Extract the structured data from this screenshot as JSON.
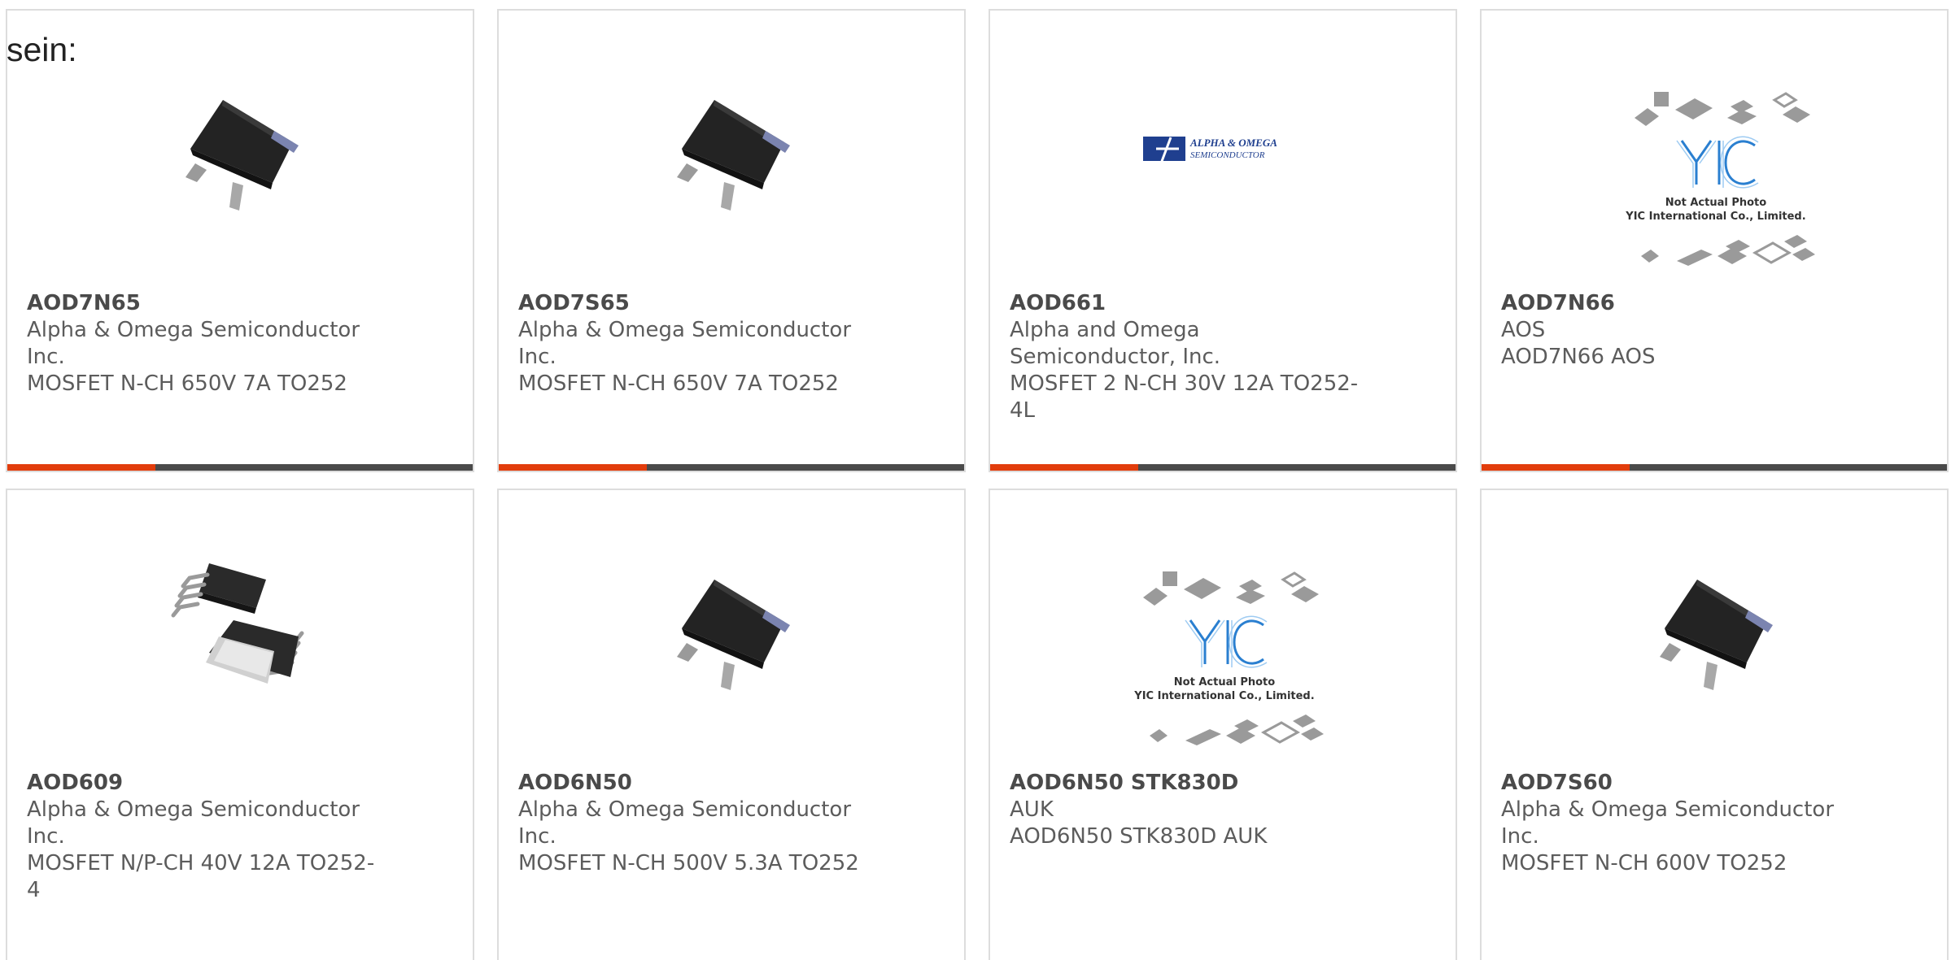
{
  "intro_text": "sein:",
  "colors": {
    "accent": "#e23d0c",
    "bar": "#4a4a4a",
    "border": "#dddddd"
  },
  "products": [
    {
      "part": "AOD7N65",
      "manufacturer": "Alpha & Omega Semiconductor Inc.",
      "description": "MOSFET N-CH 650V 7A TO252",
      "image": "to252-package-icon"
    },
    {
      "part": "AOD7S65",
      "manufacturer": "Alpha & Omega Semiconductor Inc.",
      "description": "MOSFET N-CH 650V 7A TO252",
      "image": "to252-package-icon"
    },
    {
      "part": "AOD661",
      "manufacturer": "Alpha and Omega Semiconductor, Inc.",
      "description": "MOSFET 2 N-CH 30V 12A TO252-4L",
      "image": "alpha-omega-logo",
      "logo_text": [
        "ALPHA & OMEGA",
        "SEMICONDUCTOR"
      ]
    },
    {
      "part": "AOD7N66",
      "manufacturer": "AOS",
      "description": "AOD7N66 AOS",
      "image": "yic-placeholder",
      "placeholder_text": [
        "Not Actual Photo",
        "YIC International Co., Limited."
      ]
    },
    {
      "part": "AOD609",
      "manufacturer": "Alpha & Omega Semiconductor Inc.",
      "description": "MOSFET N/P-CH 40V 12A TO252-4",
      "image": "to252-4-package-icon"
    },
    {
      "part": "AOD6N50",
      "manufacturer": "Alpha & Omega Semiconductor Inc.",
      "description": "MOSFET N-CH 500V 5.3A TO252",
      "image": "to252-package-icon"
    },
    {
      "part": "AOD6N50 STK830D",
      "manufacturer": "AUK",
      "description": "AOD6N50 STK830D AUK",
      "image": "yic-placeholder",
      "placeholder_text": [
        "Not Actual Photo",
        "YIC International Co., Limited."
      ]
    },
    {
      "part": "AOD7S60",
      "manufacturer": "Alpha & Omega Semiconductor Inc.",
      "description": "MOSFET N-CH 600V TO252",
      "image": "to252-package-icon"
    }
  ]
}
